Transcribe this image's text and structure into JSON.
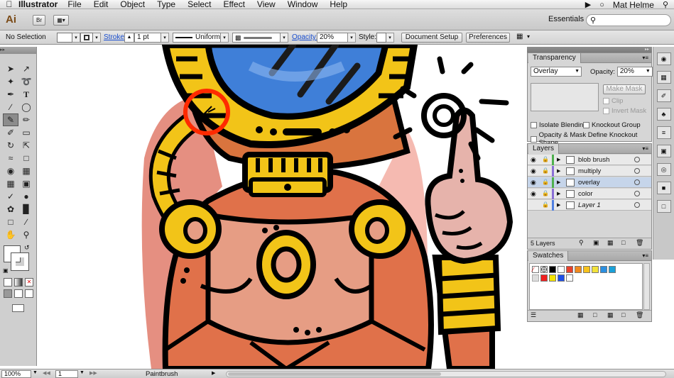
{
  "menubar": {
    "apple": "",
    "app_name": "Illustrator",
    "menus": [
      "File",
      "Edit",
      "Object",
      "Type",
      "Select",
      "Effect",
      "View",
      "Window",
      "Help"
    ],
    "user": "Mat Helme"
  },
  "appbar": {
    "logo": "Ai",
    "bridge": "Br",
    "workspace": "Essentials"
  },
  "control": {
    "selection": "No Selection",
    "stroke_label": "Stroke:",
    "stroke_weight": "1 pt",
    "profile": "Uniform",
    "opacity_label": "Opacity:",
    "opacity_value": "20%",
    "style_label": "Style:",
    "doc_setup": "Document Setup",
    "preferences": "Preferences"
  },
  "transparency": {
    "title": "Transparency",
    "blend_mode": "Overlay",
    "opacity_label": "Opacity:",
    "opacity_value": "20%",
    "make_mask": "Make Mask",
    "clip": "Clip",
    "invert_mask": "Invert Mask",
    "isolate": "Isolate Blending",
    "knockout": "Knockout Group",
    "define_knockout": "Opacity & Mask Define Knockout Shape"
  },
  "layers": {
    "title": "Layers",
    "rows": [
      {
        "name": "blob brush",
        "color": "#4fb04f"
      },
      {
        "name": "multiply",
        "color": "#8a6fd6"
      },
      {
        "name": "overlay",
        "color": "#4fb04f"
      },
      {
        "name": "color",
        "color": "#8a6fd6"
      },
      {
        "name": "Layer 1",
        "color": "#4f7fe0"
      }
    ],
    "count": "5 Layers"
  },
  "swatches": {
    "title": "Swatches",
    "colors": [
      "#e8412b",
      "#f08a1f",
      "#f6c21d",
      "#f2e23a",
      "#2b8fe0",
      "#1aa0d8",
      "#f01f1f",
      "#f5e400",
      "#1f4fe8",
      "#ffffff"
    ]
  },
  "status": {
    "zoom": "100%",
    "artboard": "1",
    "tool": "Paintbrush"
  }
}
